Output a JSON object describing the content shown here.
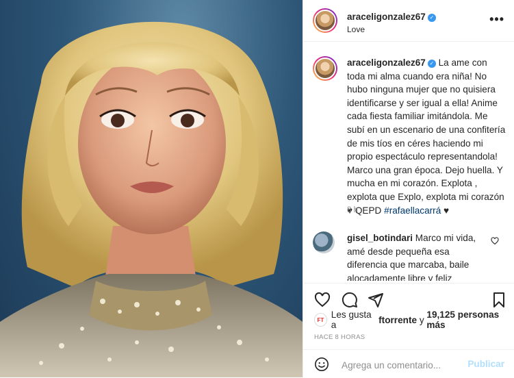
{
  "post": {
    "username": "araceligonzalez67",
    "location": "Love",
    "more_label": "•••",
    "caption": {
      "username": "araceligonzalez67",
      "text": "La ame con toda mi alma cuando era niña! No hubo ninguna mujer que no quisiera identificarse y ser igual a ella! Anime cada fiesta familiar imitándola. Me subí en un escenario de una confitería de mis tíos en céres haciendo mi propio espectáculo representandola! Marco una gran época. Dejo huella. Y mucha en mi corazón. Explota , explota que Explo, explota mi corazón ♥ QEPD ",
      "hashtag": "#rafaellacarrá",
      "end": " ♥"
    },
    "time": "8 h",
    "comment": {
      "username": "gisel_botindari",
      "text": " Marco mi vida, amé desde pequeña esa diferencia que marcaba, baile alocadamente libre y feliz"
    },
    "likes": {
      "badge": "FT",
      "prefix": "Les gusta a ",
      "user": "ftorrente",
      "middle": " y ",
      "count": "19,125 personas más"
    },
    "posted_ago": "HACE 8 HORAS",
    "add_comment": {
      "placeholder": "Agrega un comentario...",
      "publish": "Publicar"
    }
  },
  "colors": {
    "link": "#00376b",
    "verified": "#3897f0",
    "muted": "#8e8e8e",
    "publish_disabled": "#b2dffc"
  },
  "icons": [
    "verified-badge-icon",
    "heart-icon",
    "comment-icon",
    "share-icon",
    "bookmark-icon",
    "emoji-icon",
    "more-options-icon"
  ]
}
